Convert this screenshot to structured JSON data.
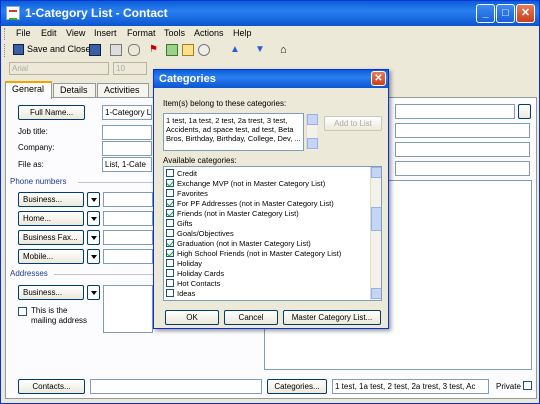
{
  "window": {
    "title": "1-Category List - Contact",
    "minimize": "_",
    "maximize": "□",
    "close": "✕"
  },
  "menu": [
    "File",
    "Edit",
    "View",
    "Insert",
    "Format",
    "Tools",
    "Actions",
    "Help"
  ],
  "toolbar": {
    "save_close": "Save and Close"
  },
  "format_bar": {
    "font": "Arial",
    "size": "10"
  },
  "tabs": [
    "General",
    "Details",
    "Activities"
  ],
  "form": {
    "full_name_button": "Full Name...",
    "full_name_value": "1-Category L",
    "job_title_label": "Job title:",
    "company_label": "Company:",
    "file_as_label": "File as:",
    "file_as_value": "List, 1-Cate",
    "phone_section": "Phone numbers",
    "phones": [
      "Business...",
      "Home...",
      "Business Fax...",
      "Mobile..."
    ],
    "addresses_section": "Addresses",
    "address_button": "Business...",
    "mailing_label": "This is the mailing address",
    "contacts_button": "Contacts...",
    "categories_button": "Categories...",
    "categories_value": "1 test, 1a test, 2 test, 2a trest, 3 test, Ac",
    "private_label": "Private"
  },
  "dialog": {
    "title": "Categories",
    "belong_label": "Item(s) belong to these categories:",
    "belong_text": "1 test, 1a test, 2 test, 2a trest, 3 test, Accidents, ad space test, ad test, Beta Bros, Birthday, Birthday, College, Dev, ...",
    "add_to_list": "Add to List",
    "available_label": "Available categories:",
    "categories": [
      {
        "label": "Credit",
        "checked": false
      },
      {
        "label": "Exchange MVP (not in Master Category List)",
        "checked": true
      },
      {
        "label": "Favorites",
        "checked": false
      },
      {
        "label": "For PF Addresses (not in Master Category List)",
        "checked": true
      },
      {
        "label": "Friends (not in Master Category List)",
        "checked": true
      },
      {
        "label": "Gifts",
        "checked": false
      },
      {
        "label": "Goals/Objectives",
        "checked": false
      },
      {
        "label": "Graduation (not in Master Category List)",
        "checked": true
      },
      {
        "label": "High School Friends (not in Master Category List)",
        "checked": true
      },
      {
        "label": "Holiday",
        "checked": false
      },
      {
        "label": "Holiday Cards",
        "checked": false
      },
      {
        "label": "Hot Contacts",
        "checked": false
      },
      {
        "label": "Ideas",
        "checked": false
      }
    ],
    "ok": "OK",
    "cancel": "Cancel",
    "master": "Master Category List..."
  }
}
